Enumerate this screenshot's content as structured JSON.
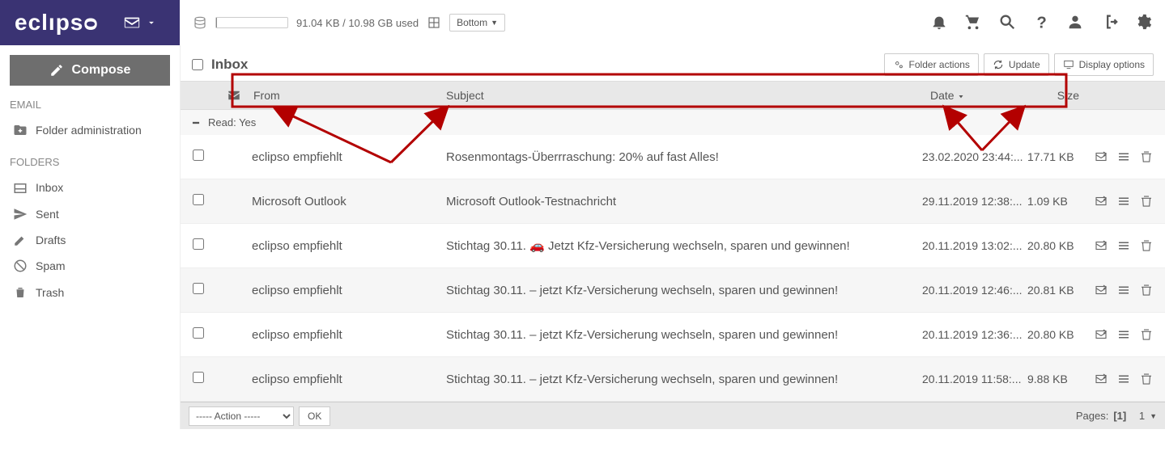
{
  "brand": "eclıpsᴑ",
  "storage": {
    "used_label": "91.04 KB / 10.98 GB used"
  },
  "layout_dropdown": "Bottom",
  "compose_label": "Compose",
  "nav": {
    "email_label": "EMAIL",
    "folder_admin": "Folder administration",
    "folders_label": "FOLDERS",
    "items": [
      {
        "label": "Inbox"
      },
      {
        "label": "Sent"
      },
      {
        "label": "Drafts"
      },
      {
        "label": "Spam"
      },
      {
        "label": "Trash"
      }
    ]
  },
  "inbox": {
    "title": "Inbox",
    "buttons": {
      "folder_actions": "Folder actions",
      "update": "Update",
      "display_options": "Display options"
    },
    "columns": {
      "from": "From",
      "subject": "Subject",
      "date": "Date",
      "size": "Size"
    },
    "group_label": "Read: Yes",
    "rows": [
      {
        "from": "eclipso empfiehlt",
        "subject": "Rosenmontags-Überrraschung: 20% auf fast Alles!",
        "date": "23.02.2020 23:44:...",
        "size": "17.71 KB"
      },
      {
        "from": "Microsoft Outlook",
        "subject": "Microsoft Outlook-Testnachricht",
        "date": "29.11.2019 12:38:...",
        "size": "1.09 KB"
      },
      {
        "from": "eclipso empfiehlt",
        "subject": "Stichtag 30.11. 🚗 Jetzt Kfz-Versicherung wechseln, sparen und gewinnen!",
        "date": "20.11.2019 13:02:...",
        "size": "20.80 KB"
      },
      {
        "from": "eclipso empfiehlt",
        "subject": "Stichtag 30.11. – jetzt Kfz-Versicherung wechseln, sparen und gewinnen!",
        "date": "20.11.2019 12:46:...",
        "size": "20.81 KB"
      },
      {
        "from": "eclipso empfiehlt",
        "subject": "Stichtag 30.11. – jetzt Kfz-Versicherung wechseln, sparen und gewinnen!",
        "date": "20.11.2019 12:36:...",
        "size": "20.80 KB"
      },
      {
        "from": "eclipso empfiehlt",
        "subject": "Stichtag 30.11. – jetzt Kfz-Versicherung wechseln, sparen und gewinnen!",
        "date": "20.11.2019 11:58:...",
        "size": "9.88 KB"
      }
    ],
    "footer": {
      "action_placeholder": "----- Action -----",
      "ok": "OK",
      "pages_label": "Pages:",
      "current_page": "[1]",
      "page_count": "1"
    }
  }
}
